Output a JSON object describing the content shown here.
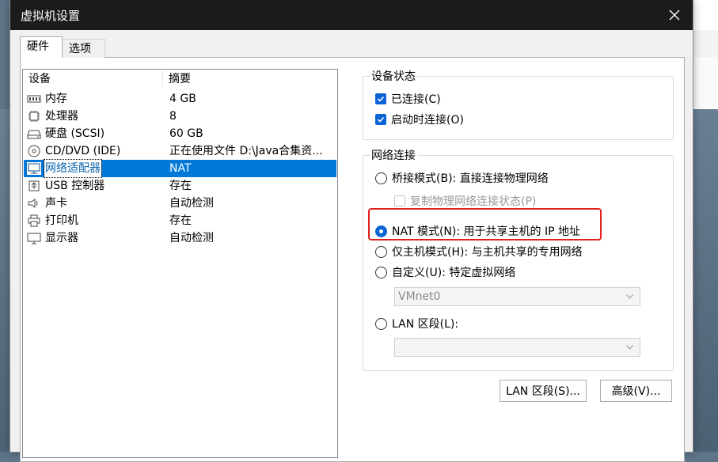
{
  "window": {
    "title": "虚拟机设置"
  },
  "tabs": [
    {
      "label": "硬件",
      "active": true
    },
    {
      "label": "选项",
      "active": false
    }
  ],
  "device_list": {
    "headers": {
      "device": "设备",
      "summary": "摘要"
    },
    "rows": [
      {
        "icon": "memory-icon",
        "name": "内存",
        "summary": "4 GB"
      },
      {
        "icon": "cpu-icon",
        "name": "处理器",
        "summary": "8"
      },
      {
        "icon": "hard-disk-icon",
        "name": "硬盘 (SCSI)",
        "summary": "60 GB"
      },
      {
        "icon": "cd-dvd-icon",
        "name": "CD/DVD (IDE)",
        "summary": "正在使用文件 D:\\Java合集资..."
      },
      {
        "icon": "network-adapter-icon",
        "name": "网络适配器",
        "summary": "NAT",
        "selected": true
      },
      {
        "icon": "usb-icon",
        "name": "USB 控制器",
        "summary": "存在"
      },
      {
        "icon": "sound-card-icon",
        "name": "声卡",
        "summary": "自动检测"
      },
      {
        "icon": "printer-icon",
        "name": "打印机",
        "summary": "存在"
      },
      {
        "icon": "display-icon",
        "name": "显示器",
        "summary": "自动检测"
      }
    ]
  },
  "device_status": {
    "title": "设备状态",
    "connected": {
      "label": "已连接(C)",
      "checked": true
    },
    "connect_at_power_on": {
      "label": "启动时连接(O)",
      "checked": true
    }
  },
  "network": {
    "title": "网络连接",
    "bridged": {
      "label": "桥接模式(B): 直接连接物理网络",
      "selected": false
    },
    "replicate": {
      "label": "复制物理网络连接状态(P)",
      "checked": false,
      "enabled": false
    },
    "nat": {
      "label": "NAT 模式(N): 用于共享主机的 IP 地址",
      "selected": true
    },
    "host_only": {
      "label": "仅主机模式(H): 与主机共享的专用网络",
      "selected": false
    },
    "custom": {
      "label": "自定义(U): 特定虚拟网络",
      "selected": false
    },
    "custom_combo": {
      "value": "VMnet0",
      "enabled": false
    },
    "lan_segment": {
      "label": "LAN 区段(L):",
      "selected": false
    },
    "lan_combo": {
      "value": "",
      "enabled": false
    }
  },
  "buttons": {
    "lan_segments": "LAN 区段(S)...",
    "advanced": "高级(V)..."
  },
  "colors": {
    "accent": "#0a64d6",
    "selection": "#0078d7",
    "highlight_border": "#e02020",
    "titlebar": "#1b1b1b"
  }
}
